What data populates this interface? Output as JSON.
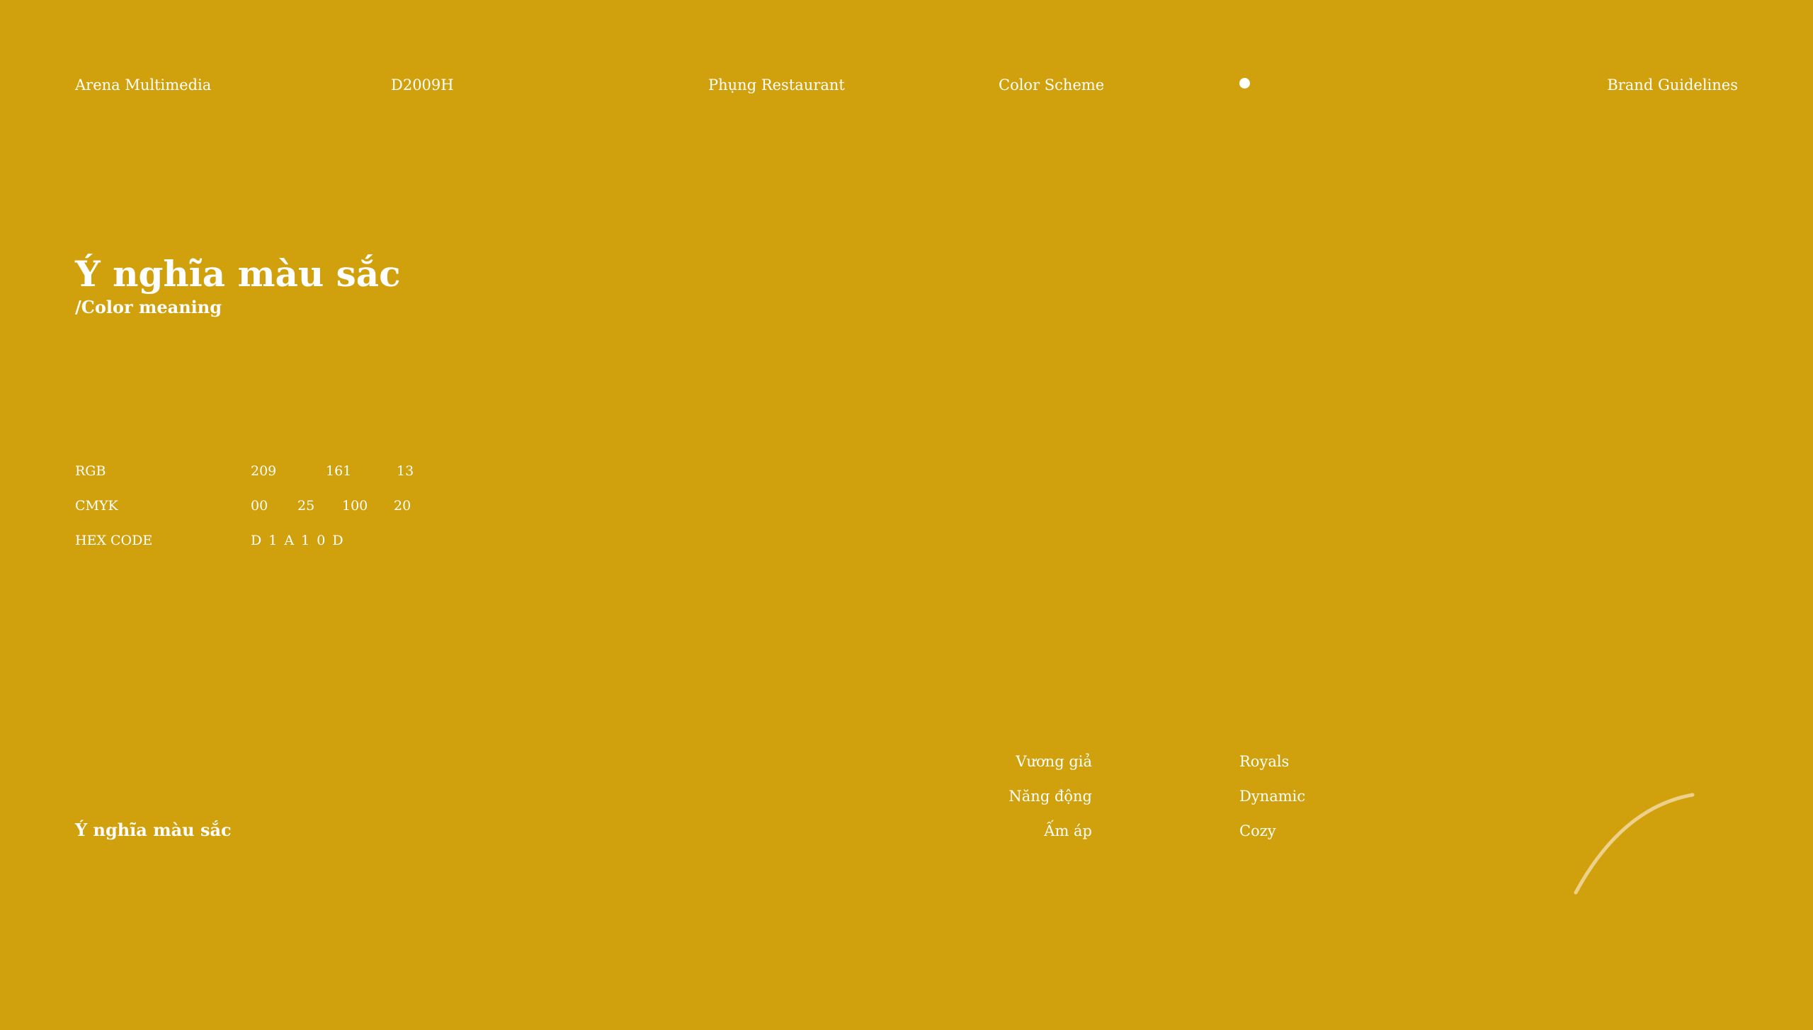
{
  "colors": {
    "background": "#D1A10D",
    "text": "#FFFFFF",
    "arc": "#EDD08A"
  },
  "header": {
    "organization": "Arena Multimedia",
    "class_code": "D2009H",
    "project": "Phụng Restaurant",
    "section": "Color Scheme",
    "dot_icon": "dot-icon",
    "document": "Brand Guidelines"
  },
  "title": {
    "main": "Ý nghĩa màu sắc",
    "sub": "/Color meaning"
  },
  "specs": {
    "rgb": {
      "label": "RGB",
      "r": "209",
      "g": "161",
      "b": "13"
    },
    "cmyk": {
      "label": "CMYK",
      "c": "00",
      "m": "25",
      "y": "100",
      "k": "20"
    },
    "hex": {
      "label": "HEX CODE",
      "value": "D 1 A 1 0 D"
    }
  },
  "bottom": {
    "title": "Ý nghĩa màu sắc",
    "meanings": [
      {
        "vi": "Vương giả",
        "en": "Royals"
      },
      {
        "vi": "Năng động",
        "en": "Dynamic"
      },
      {
        "vi": "Ấm áp",
        "en": "Cozy"
      }
    ]
  }
}
